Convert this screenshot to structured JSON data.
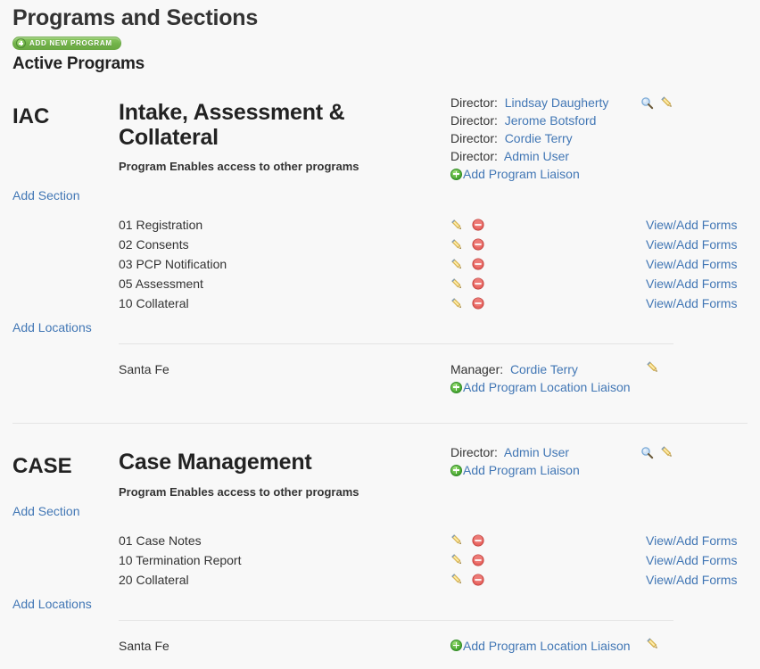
{
  "header": {
    "title": "Programs and Sections",
    "add_new_program_label": "Add New Program",
    "active_programs_label": "Active Programs",
    "add_icon": "plus-circle-icon"
  },
  "labels": {
    "director_prefix": "Director:",
    "manager_prefix": "Manager:",
    "add_program_liaison": "Add Program Liaison",
    "add_program_location_liaison": "Add Program Location Liaison",
    "add_section": "Add Section",
    "add_locations": "Add Locations",
    "view_add_forms": "View/Add Forms",
    "program_enables_note": "Program Enables access to other programs"
  },
  "icons": {
    "search": "magnifier-icon",
    "edit": "pencil-icon",
    "delete": "delete-circle-icon",
    "add": "plus-circle-icon"
  },
  "colors": {
    "background": "#f8f8f8",
    "link": "#4277b5",
    "text": "#333333",
    "accent_green": "#72b349",
    "delete_red": "#e05c5c",
    "pencil_yellow": "#f2d06b",
    "divider": "#e4e4e4"
  },
  "programs": [
    {
      "code": "IAC",
      "name": "Intake, Assessment & Collateral",
      "note": "Program Enables access to other programs",
      "directors": [
        "Lindsay Daugherty",
        "Jerome Botsford",
        "Cordie Terry",
        "Admin User"
      ],
      "sections": [
        {
          "name": "01 Registration",
          "forms_link": "View/Add Forms"
        },
        {
          "name": "02 Consents",
          "forms_link": "View/Add Forms"
        },
        {
          "name": "03 PCP Notification",
          "forms_link": "View/Add Forms"
        },
        {
          "name": "05 Assessment",
          "forms_link": "View/Add Forms"
        },
        {
          "name": "10 Collateral",
          "forms_link": "View/Add Forms"
        }
      ],
      "locations": [
        {
          "name": "Santa Fe",
          "manager": "Cordie Terry",
          "has_manager": true
        }
      ]
    },
    {
      "code": "CASE",
      "name": "Case Management",
      "note": "Program Enables access to other programs",
      "directors": [
        "Admin User"
      ],
      "sections": [
        {
          "name": "01 Case Notes",
          "forms_link": "View/Add Forms"
        },
        {
          "name": "10 Termination Report",
          "forms_link": "View/Add Forms"
        },
        {
          "name": "20 Collateral",
          "forms_link": "View/Add Forms"
        }
      ],
      "locations": [
        {
          "name": "Santa Fe",
          "manager": "",
          "has_manager": false
        }
      ]
    }
  ]
}
